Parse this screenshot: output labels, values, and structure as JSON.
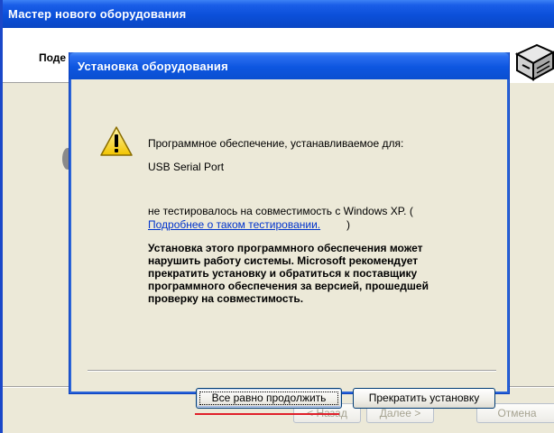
{
  "wizard": {
    "title": "Мастер нового оборудования",
    "header_title": "Поде",
    "buttons": {
      "back": "< Назад",
      "next": "Далее >",
      "cancel": "Отмена"
    }
  },
  "dialog": {
    "title": "Установка оборудования",
    "intro": "Программное обеспечение, устанавливаемое для:",
    "device": "USB Serial Port",
    "not_tested": "не тестировалось на совместимость с Windows XP. (",
    "link": "Подробнее о таком тестировании.",
    "link_close": ")",
    "warning_lines": [
      "Установка этого программного обеспечения может",
      "нарушить работу системы. Microsoft рекомендует",
      "прекратить установку и обратиться к поставщику",
      "программного обеспечения за версией, прошедшей",
      "проверку на совместимость."
    ],
    "buttons": {
      "continue": "Все равно продолжить",
      "stop": "Прекратить установку"
    }
  },
  "colors": {
    "titlebar": "#0b4fd9",
    "link": "#0033cc",
    "highlight_underline": "#e0202a"
  },
  "icons": {
    "warning": "warning-icon",
    "hardware": "hardware-wizard-icon"
  }
}
